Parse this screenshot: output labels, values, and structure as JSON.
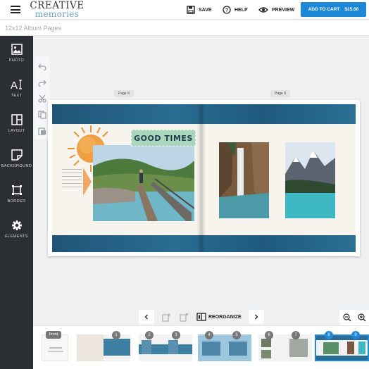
{
  "header": {
    "logo_line1": "CREATIVE",
    "logo_line2": "memories",
    "save_label": "SAVE",
    "help_label": "HELP",
    "preview_label": "PREVIEW",
    "cart_label": "ADD TO CART",
    "cart_price": "$15.00"
  },
  "project": {
    "title": "12x12 Album Pages"
  },
  "tools": [
    {
      "label": "PHOTO",
      "icon": "image-icon"
    },
    {
      "label": "TEXT",
      "icon": "text-icon"
    },
    {
      "label": "LAYOUT",
      "icon": "layout-icon"
    },
    {
      "label": "BACKGROUND",
      "icon": "background-icon"
    },
    {
      "label": "BORDER",
      "icon": "border-icon"
    },
    {
      "label": "ELEMENTS",
      "icon": "gear-icon"
    }
  ],
  "edit_tools": [
    "undo-icon",
    "redo-icon",
    "cut-icon",
    "copy-icon",
    "paste-icon"
  ],
  "spread": {
    "left_page_label": "Page 8",
    "right_page_label": "Page 9",
    "sticker_text": "GOOD TIMES"
  },
  "bottom_controls": {
    "reorganize_label": "REORGANIZE"
  },
  "filmstrip": {
    "front_label": "Front",
    "page_numbers": [
      "1",
      "2",
      "3",
      "4",
      "5",
      "6",
      "7",
      "8",
      "9"
    ],
    "selected_pages": [
      "8",
      "9"
    ]
  },
  "colors": {
    "accent": "#1e88d8",
    "sidebar": "#2b2f34",
    "band": "#2a6c92",
    "sticker": "#a9d6bd"
  }
}
